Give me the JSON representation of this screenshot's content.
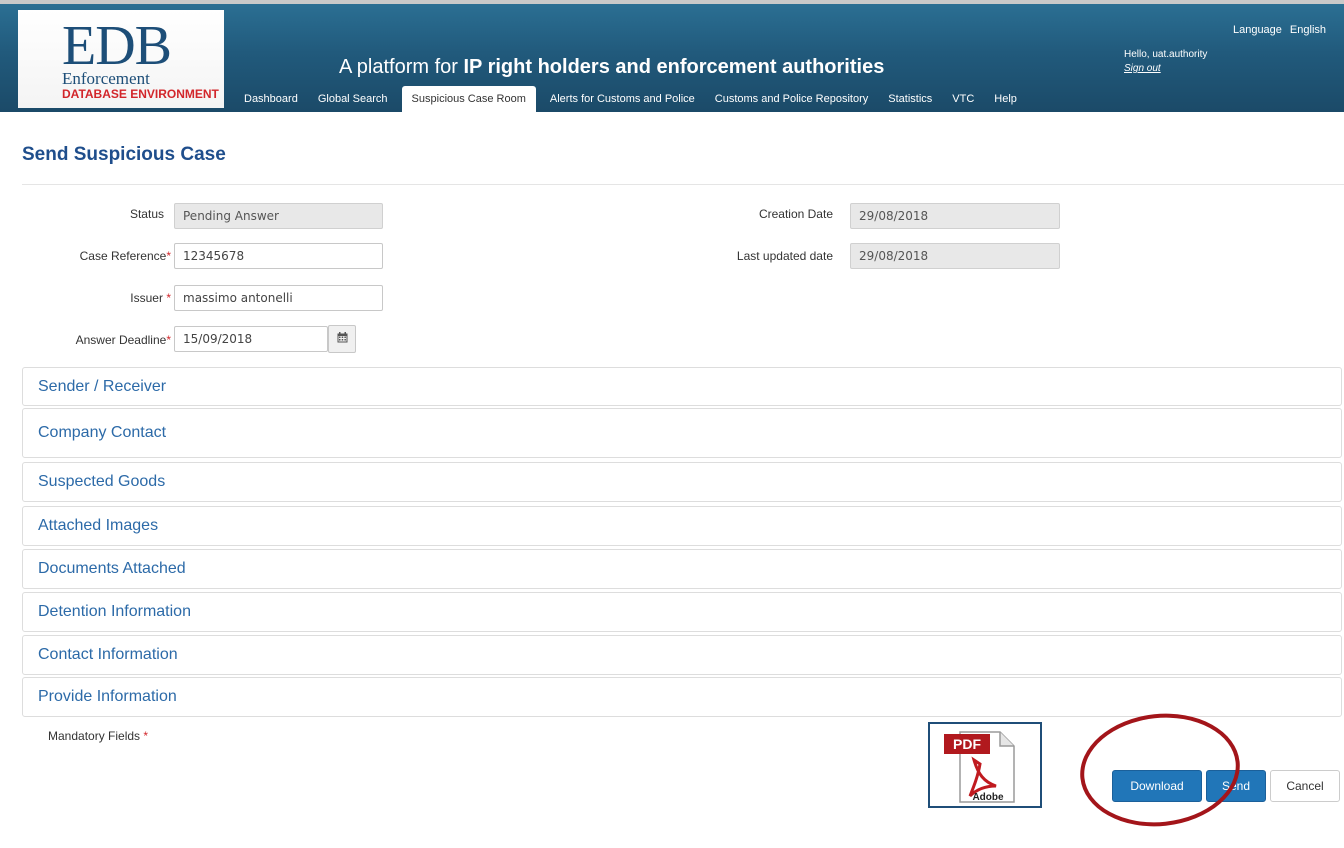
{
  "header": {
    "logo_title": "EDB",
    "logo_subtitle": "Enforcement",
    "logo_environment": "DATABASE ENVIRONMENT",
    "tagline_prefix": "A platform for ",
    "tagline_bold": "IP right holders and enforcement authorities",
    "language_label": "Language",
    "language_value": "English",
    "greeting": "Hello, uat.authority",
    "sign_out": "Sign out"
  },
  "nav": [
    {
      "label": "Dashboard"
    },
    {
      "label": "Global Search"
    },
    {
      "label": "Suspicious Case Room",
      "active": true
    },
    {
      "label": "Alerts for Customs and Police"
    },
    {
      "label": "Customs and Police Repository"
    },
    {
      "label": "Statistics"
    },
    {
      "label": "VTC"
    },
    {
      "label": "Help"
    }
  ],
  "page": {
    "title": "Send Suspicious Case"
  },
  "form": {
    "status_label": "Status",
    "status_value": "Pending Answer",
    "case_reference_label": "Case Reference",
    "case_reference_value": "12345678",
    "issuer_label": "Issuer",
    "issuer_value": "massimo antonelli",
    "answer_deadline_label": "Answer Deadline",
    "answer_deadline_value": "15/09/2018",
    "creation_date_label": "Creation Date",
    "creation_date_value": "29/08/2018",
    "last_updated_label": "Last updated date",
    "last_updated_value": "29/08/2018",
    "required_mark": "*"
  },
  "sections": [
    "Sender / Receiver",
    "Company Contact",
    "Suspected Goods",
    "Attached Images",
    "Documents Attached",
    "Detention Information",
    "Contact Information",
    "Provide Information"
  ],
  "footer": {
    "mandatory_label": "Mandatory Fields",
    "pdf_badge": "PDF",
    "pdf_brand": "Adobe",
    "download_label": "Download",
    "send_label": "Send",
    "cancel_label": "Cancel"
  },
  "colors": {
    "header_bg": "#215a7c",
    "title_blue": "#1f4e8c",
    "section_blue": "#2c6aa8",
    "primary_button": "#2176b8",
    "required_red": "#d2262b",
    "highlight_circle": "#a3151a"
  },
  "icons": {
    "calendar": "calendar-icon",
    "pdf": "pdf-document-icon"
  }
}
